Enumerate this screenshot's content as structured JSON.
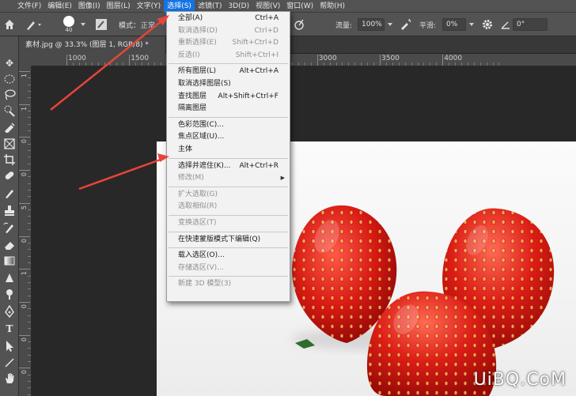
{
  "menubar": {
    "items": [
      {
        "label": "文件(F)"
      },
      {
        "label": "编辑(E)"
      },
      {
        "label": "图像(I)"
      },
      {
        "label": "图层(L)"
      },
      {
        "label": "文字(Y)"
      },
      {
        "label": "选择(S)",
        "active": true
      },
      {
        "label": "滤镜(T)"
      },
      {
        "label": "3D(D)"
      },
      {
        "label": "视图(V)"
      },
      {
        "label": "窗口(W)"
      },
      {
        "label": "帮助(H)"
      }
    ]
  },
  "options": {
    "brush_size": "40",
    "mode_label": "模式：",
    "mode_value": "正常",
    "flow_label": "流量:",
    "flow_value": "100%",
    "smoothing_label": "平滑:",
    "smoothing_value": "0%",
    "angle_value": "0°"
  },
  "document_tab": {
    "title": "素材.jpg @ 33.3% (图层 1, RGB/8) *"
  },
  "ruler": {
    "h_labels": [
      "1000",
      "1500",
      "2000",
      "2500",
      "3000",
      "3500",
      "4000"
    ],
    "v_labels": [
      "1",
      "1",
      "0",
      "0",
      "5",
      "0",
      "1",
      "0",
      "0",
      "0"
    ]
  },
  "select_menu": {
    "groups": [
      [
        {
          "label": "全部(A)",
          "shortcut": "Ctrl+A",
          "disabled": false
        },
        {
          "label": "取消选择(D)",
          "shortcut": "Ctrl+D",
          "disabled": true
        },
        {
          "label": "重新选择(E)",
          "shortcut": "Shift+Ctrl+D",
          "disabled": true
        },
        {
          "label": "反选(I)",
          "shortcut": "Shift+Ctrl+I",
          "disabled": true
        }
      ],
      [
        {
          "label": "所有图层(L)",
          "shortcut": "Alt+Ctrl+A",
          "disabled": false
        },
        {
          "label": "取消选择图层(S)",
          "shortcut": "",
          "disabled": false
        },
        {
          "label": "查找图层",
          "shortcut": "Alt+Shift+Ctrl+F",
          "disabled": false
        },
        {
          "label": "隔离图层",
          "shortcut": "",
          "disabled": false
        }
      ],
      [
        {
          "label": "色彩范围(C)...",
          "shortcut": "",
          "disabled": false
        },
        {
          "label": "焦点区域(U)...",
          "shortcut": "",
          "disabled": false
        },
        {
          "label": "主体",
          "shortcut": "",
          "disabled": false
        }
      ],
      [
        {
          "label": "选择并遮住(K)...",
          "shortcut": "Alt+Ctrl+R",
          "disabled": false
        },
        {
          "label": "修改(M)",
          "shortcut": "",
          "disabled": true,
          "submenu": true
        }
      ],
      [
        {
          "label": "扩大选取(G)",
          "shortcut": "",
          "disabled": true
        },
        {
          "label": "选取相似(R)",
          "shortcut": "",
          "disabled": true
        }
      ],
      [
        {
          "label": "变换选区(T)",
          "shortcut": "",
          "disabled": true
        }
      ],
      [
        {
          "label": "在快速蒙版模式下编辑(Q)",
          "shortcut": "",
          "disabled": false
        }
      ],
      [
        {
          "label": "载入选区(O)...",
          "shortcut": "",
          "disabled": false
        },
        {
          "label": "存储选区(V)...",
          "shortcut": "",
          "disabled": true
        }
      ],
      [
        {
          "label": "新建 3D 模型(3)",
          "shortcut": "",
          "disabled": true
        }
      ]
    ]
  },
  "watermark": {
    "text": "UiBQ.CoM"
  },
  "colors": {
    "accent": "#1473e6",
    "arrow": "#e8443a",
    "menu_bg": "#f2f2f2",
    "panel": "#535353"
  }
}
